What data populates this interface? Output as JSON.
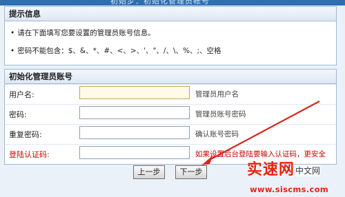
{
  "header": {
    "title": "初始步：初始化管理员帐号"
  },
  "tips": {
    "title": "提示信息",
    "items": [
      "请在下面填写您要设置的管理员账号信息。",
      "密码不能包含：$、&、*、#、<、>、'、\"、/、\\、%、;、空格"
    ]
  },
  "form": {
    "title": "初始化管理员账号",
    "fields": [
      {
        "label": "用户名:",
        "value": "",
        "hint": "管理员用户名"
      },
      {
        "label": "密码:",
        "value": "",
        "hint": "管理员账号密码"
      },
      {
        "label": "重复密码:",
        "value": "",
        "hint": "确认账号密码"
      },
      {
        "label": "登陆认证码:",
        "value": "",
        "hint": "如果设置后台登陆要输入认证码，更安全"
      }
    ]
  },
  "buttons": {
    "prev": "上一步",
    "next": "下一步"
  },
  "watermark": {
    "brand": "实速网",
    "sub": "中文网",
    "url": "www.siscms.com"
  },
  "colors": {
    "accent_red": "#cc0000",
    "header_blue": "#2f6fb0"
  }
}
